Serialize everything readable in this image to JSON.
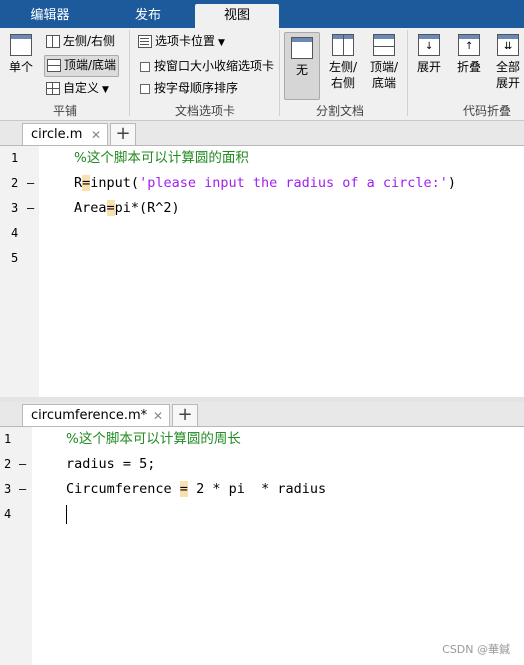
{
  "top_tabs": [
    {
      "label": "编辑器",
      "active": false
    },
    {
      "label": "发布",
      "active": false
    },
    {
      "label": "视图",
      "active": true
    }
  ],
  "ribbon": {
    "tile": {
      "single_label": "单个",
      "left_right_label": "左侧/右侧",
      "top_bottom_label": "顶端/底端",
      "custom_label": "自定义",
      "section_label": "平铺"
    },
    "doc_tabs": {
      "tab_position_label": "选项卡位置",
      "shrink_tabs_label": "按窗口大小收缩选项卡",
      "alpha_sort_label": "按字母顺序排序",
      "section_label": "文档选项卡"
    },
    "split": {
      "none_label": "无",
      "left_right_label_1": "左侧/",
      "left_right_label_2": "右侧",
      "top_bottom_label_1": "顶端/",
      "top_bottom_label_2": "底端",
      "section_label": "分割文档"
    },
    "fold": {
      "expand_label": "展开",
      "collapse_label": "折叠",
      "all_expand_label_1": "全部",
      "all_expand_label_2": "展开",
      "section_label": "代码折叠"
    }
  },
  "editor1": {
    "tab_name": "circle.m",
    "close_glyph": "✕",
    "add_glyph": "+",
    "lines": [
      {
        "num": "1",
        "dash": "",
        "text": "%这个脚本可以计算圆的面积"
      },
      {
        "num": "2",
        "dash": "—",
        "pre": "R",
        "hl": "=",
        "post": "input(",
        "str": "'please input the radius of a circle:'",
        "tail": ")"
      },
      {
        "num": "3",
        "dash": "—",
        "pre": "Area",
        "hl": "=",
        "post": "pi*(R^2)"
      },
      {
        "num": "4",
        "dash": "",
        "text": ""
      },
      {
        "num": "5",
        "dash": "",
        "text": ""
      }
    ]
  },
  "editor2": {
    "tab_name": "circumference.m*",
    "close_glyph": "✕",
    "add_glyph": "+",
    "lines": [
      {
        "num": "1",
        "dash": "",
        "text": "%这个脚本可以计算圆的周长"
      },
      {
        "num": "2",
        "dash": "—",
        "text": "radius = 5;"
      },
      {
        "num": "3",
        "dash": "—",
        "pre": "Circumference ",
        "hl": "=",
        "post": " 2 * pi  * radius"
      },
      {
        "num": "4",
        "dash": "",
        "text": ""
      }
    ]
  },
  "watermark": "CSDN @華鍼",
  "colors": {
    "tabbar": "#1d5a9b",
    "comment": "#228b22",
    "string": "#a020f0",
    "highlight": "#f9e0b0"
  }
}
